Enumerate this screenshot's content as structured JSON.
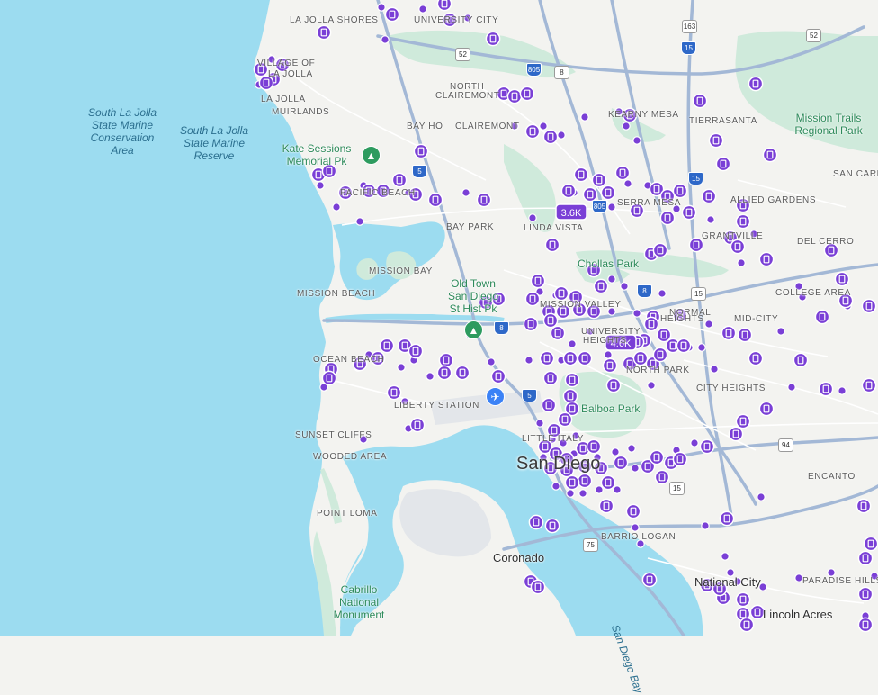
{
  "colors": {
    "water": "#9cdcf0",
    "land": "#f3f3f0",
    "park": "#cfeadb",
    "marker": "#7a3fd6",
    "road": "#a3b8d6",
    "airport": "#e3e6ea"
  },
  "markers": {
    "clusters": [
      {
        "label": "3.6K"
      },
      {
        "label": "4.6K"
      }
    ]
  },
  "labels": {
    "la_jolla_shores": "LA JOLLA SHORES",
    "university_city": "UNIVERSITY CITY",
    "village_of": "VILLAGE OF",
    "la_jolla": "LA JOLLA",
    "la_jolla_muirlands_1": "LA JOLLA",
    "la_jolla_muirlands_2": "MUIRLANDS",
    "north_clairemont_1": "NORTH",
    "north_clairemont_2": "CLAIREMONT",
    "kearny_mesa": "KEARNY MESA",
    "tierrasanta": "TIERRASANTA",
    "bay_ho": "BAY HO",
    "clairemont": "CLAIREMONT",
    "san_carlos": "SAN CARL",
    "pacific_beach": "PACIFIC BEACH",
    "serra_mesa": "SERRA MESA",
    "allied_gardens": "ALLIED GARDENS",
    "bay_park": "BAY PARK",
    "linda_vista": "LINDA VISTA",
    "grantville": "GRANTVILLE",
    "del_cerro": "DEL CERRO",
    "mission_bay": "MISSION BAY",
    "mission_beach": "MISSION BEACH",
    "college_area": "COLLEGE AREA",
    "mission_valley": "MISSION VALLEY",
    "normal_heights_1": "NORMAL",
    "normal_heights_2": "HEIGHTS",
    "mid_city": "MID-CITY",
    "university_heights_1": "UNIVERSITY",
    "university_heights_2": "HEIGHTS",
    "ocean_beach": "OCEAN BEACH",
    "north_park": "NORTH PARK",
    "city_heights": "CITY HEIGHTS",
    "liberty_station": "LIBERTY STATION",
    "sunset_cliffs": "SUNSET CLIFFS",
    "wooded_area": "WOODED AREA",
    "little_italy": "LITTLE ITALY",
    "encanto": "ENCANTO",
    "point_loma": "POINT LOMA",
    "barrio_logan": "BARRIO LOGAN",
    "paradise_hills": "PARADISE HILLS",
    "coronado": "Coronado",
    "san_diego": "San Diego",
    "national_city": "National City",
    "lincoln_acres": "Lincoln Acres",
    "sd_bay": "San Diego Bay"
  },
  "water_labels": {
    "smc_1": "South La Jolla",
    "smc_2": "State Marine",
    "smc_3": "Conservation",
    "smc_4": "Area",
    "smr_1": "South La Jolla",
    "smr_2": "State Marine",
    "smr_3": "Reserve"
  },
  "parks": {
    "kate_1": "Kate Sessions",
    "kate_2": "Memorial Pk",
    "old_town_1": "Old Town",
    "old_town_2": "San Diego",
    "old_town_3": "St Hist Pk",
    "mission_trails_1": "Mission Trails",
    "mission_trails_2": "Regional Park",
    "balboa": "Balboa Park",
    "chollas": "Chollas Park",
    "cabrillo_1": "Cabrillo",
    "cabrillo_2": "National",
    "cabrillo_3": "Monument"
  },
  "highways": {
    "i5a": "5",
    "i5b": "5",
    "i5c": "5",
    "i805a": "805",
    "i805b": "805",
    "i15a": "15",
    "i15b": "15",
    "i8a": "8",
    "i8b": "8",
    "i8c": "8",
    "sr52a": "52",
    "sr52b": "52",
    "sr163": "163",
    "sr94": "94",
    "sr75": "75",
    "sr15": "15",
    "sr163b": "163"
  }
}
